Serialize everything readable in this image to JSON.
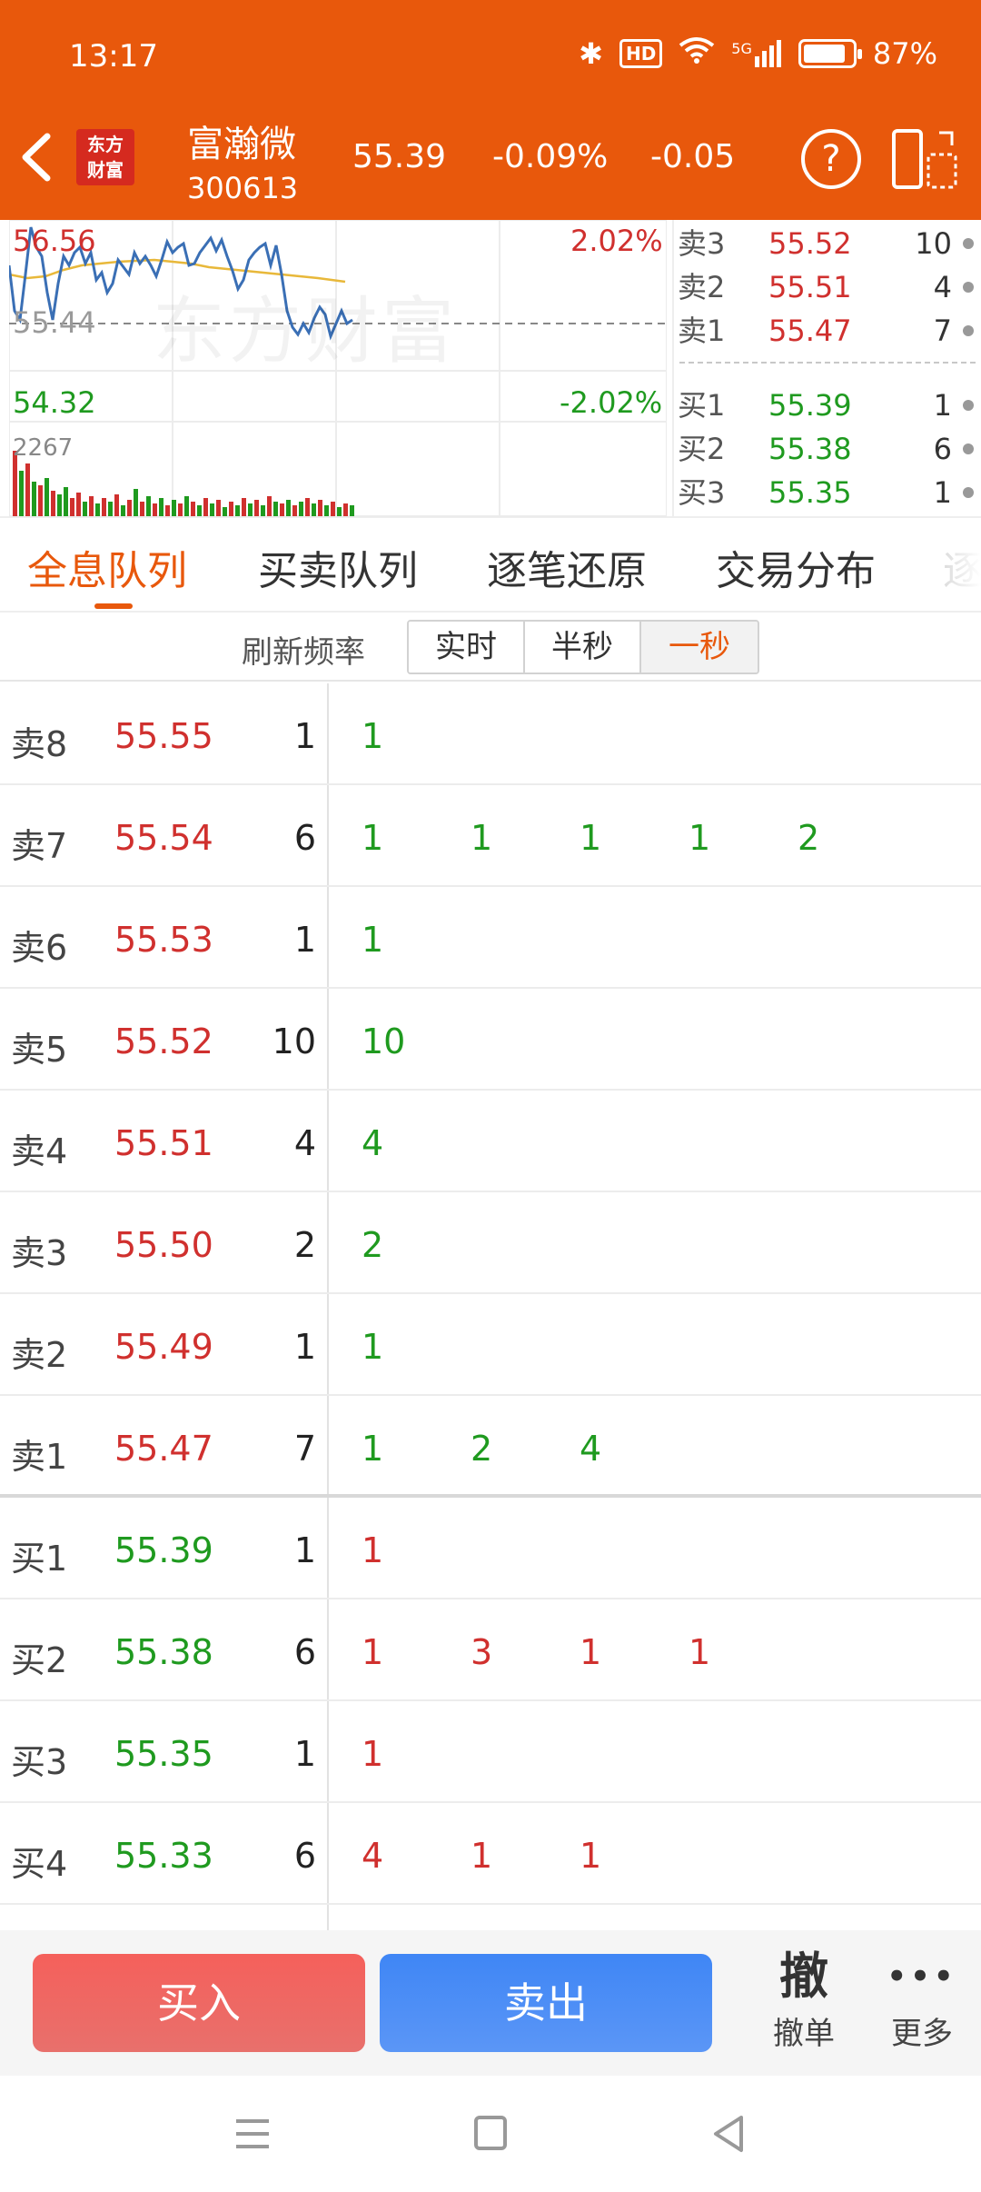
{
  "status": {
    "time": "13:17",
    "hd": "HD",
    "signal": "5G",
    "battery": "87%"
  },
  "header": {
    "logo_line1": "东方",
    "logo_line2": "财富",
    "name": "富瀚微",
    "code": "300613",
    "price": "55.39",
    "pct": "-0.09%",
    "change": "-0.05",
    "help": "?"
  },
  "chart": {
    "high_price": "56.56",
    "high_pct": "2.02%",
    "mid_price": "55.44",
    "low_price": "54.32",
    "low_pct": "-2.02%",
    "volume_label": "2267",
    "watermark": "东方财富",
    "price_line_color": "#3a6fb5",
    "avg_line_color": "#e8b83a"
  },
  "orderbook": {
    "asks": [
      {
        "label": "卖3",
        "price": "55.52",
        "vol": "10"
      },
      {
        "label": "卖2",
        "price": "55.51",
        "vol": "4"
      },
      {
        "label": "卖1",
        "price": "55.47",
        "vol": "7"
      }
    ],
    "bids": [
      {
        "label": "买1",
        "price": "55.39",
        "vol": "1"
      },
      {
        "label": "买2",
        "price": "55.38",
        "vol": "6"
      },
      {
        "label": "买3",
        "price": "55.35",
        "vol": "1"
      }
    ]
  },
  "tabs": [
    "全息队列",
    "买卖队列",
    "逐笔还原",
    "交易分布",
    "逐"
  ],
  "refresh": {
    "label": "刷新频率",
    "options": [
      "实时",
      "半秒",
      "一秒"
    ]
  },
  "queue": {
    "asks": [
      {
        "label": "卖8",
        "price": "55.55",
        "total": "1",
        "items": [
          "1"
        ]
      },
      {
        "label": "卖7",
        "price": "55.54",
        "total": "6",
        "items": [
          "1",
          "1",
          "1",
          "1",
          "2"
        ]
      },
      {
        "label": "卖6",
        "price": "55.53",
        "total": "1",
        "items": [
          "1"
        ]
      },
      {
        "label": "卖5",
        "price": "55.52",
        "total": "10",
        "items": [
          "10"
        ]
      },
      {
        "label": "卖4",
        "price": "55.51",
        "total": "4",
        "items": [
          "4"
        ]
      },
      {
        "label": "卖3",
        "price": "55.50",
        "total": "2",
        "items": [
          "2"
        ]
      },
      {
        "label": "卖2",
        "price": "55.49",
        "total": "1",
        "items": [
          "1"
        ]
      },
      {
        "label": "卖1",
        "price": "55.47",
        "total": "7",
        "items": [
          "1",
          "2",
          "4"
        ]
      }
    ],
    "bids": [
      {
        "label": "买1",
        "price": "55.39",
        "total": "1",
        "items": [
          "1"
        ]
      },
      {
        "label": "买2",
        "price": "55.38",
        "total": "6",
        "items": [
          "1",
          "3",
          "1",
          "1"
        ]
      },
      {
        "label": "买3",
        "price": "55.35",
        "total": "1",
        "items": [
          "1"
        ]
      },
      {
        "label": "买4",
        "price": "55.33",
        "total": "6",
        "items": [
          "4",
          "1",
          "1"
        ]
      }
    ]
  },
  "actions": {
    "buy": "买入",
    "sell": "卖出",
    "cancel_icon": "撤",
    "cancel": "撤单",
    "more_icon": "•••",
    "more": "更多"
  },
  "colors": {
    "brand": "#e8580c",
    "up": "#d0302e",
    "down": "#1f9a1f"
  }
}
